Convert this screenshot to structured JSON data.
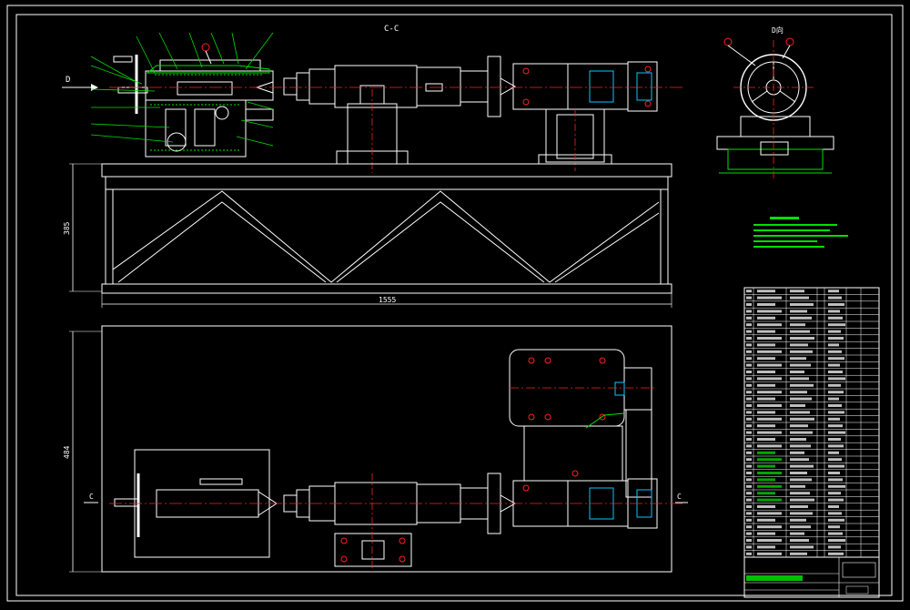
{
  "views": {
    "section_label": "C-C",
    "view_d_label": "D向",
    "arrow_d_label": "D",
    "cut_left_label": "C",
    "cut_right_label": "C"
  },
  "dimensions": {
    "total_length": "1555",
    "frame_height": "385",
    "plan_height": "484"
  },
  "colors": {
    "background": "#000000",
    "outline": "#ffffff",
    "centerline": "#ff2020",
    "leader": "#00e000",
    "hidden": "#00c8ff",
    "accent_cyan": "#00ffff"
  }
}
